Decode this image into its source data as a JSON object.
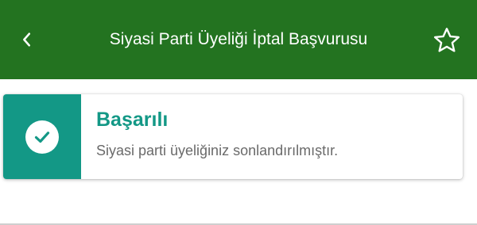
{
  "header": {
    "title": "Siyasi Parti Üyeliği İptal Başvurusu",
    "back_icon": "chevron-left-icon",
    "favorite_icon": "star-outline-icon",
    "background_color": "#237320"
  },
  "result_card": {
    "status_icon": "check-circle-icon",
    "title": "Başarılı",
    "message": "Siyasi parti üyeliğiniz sonlandırılmıştır.",
    "accent_color": "#139886"
  }
}
